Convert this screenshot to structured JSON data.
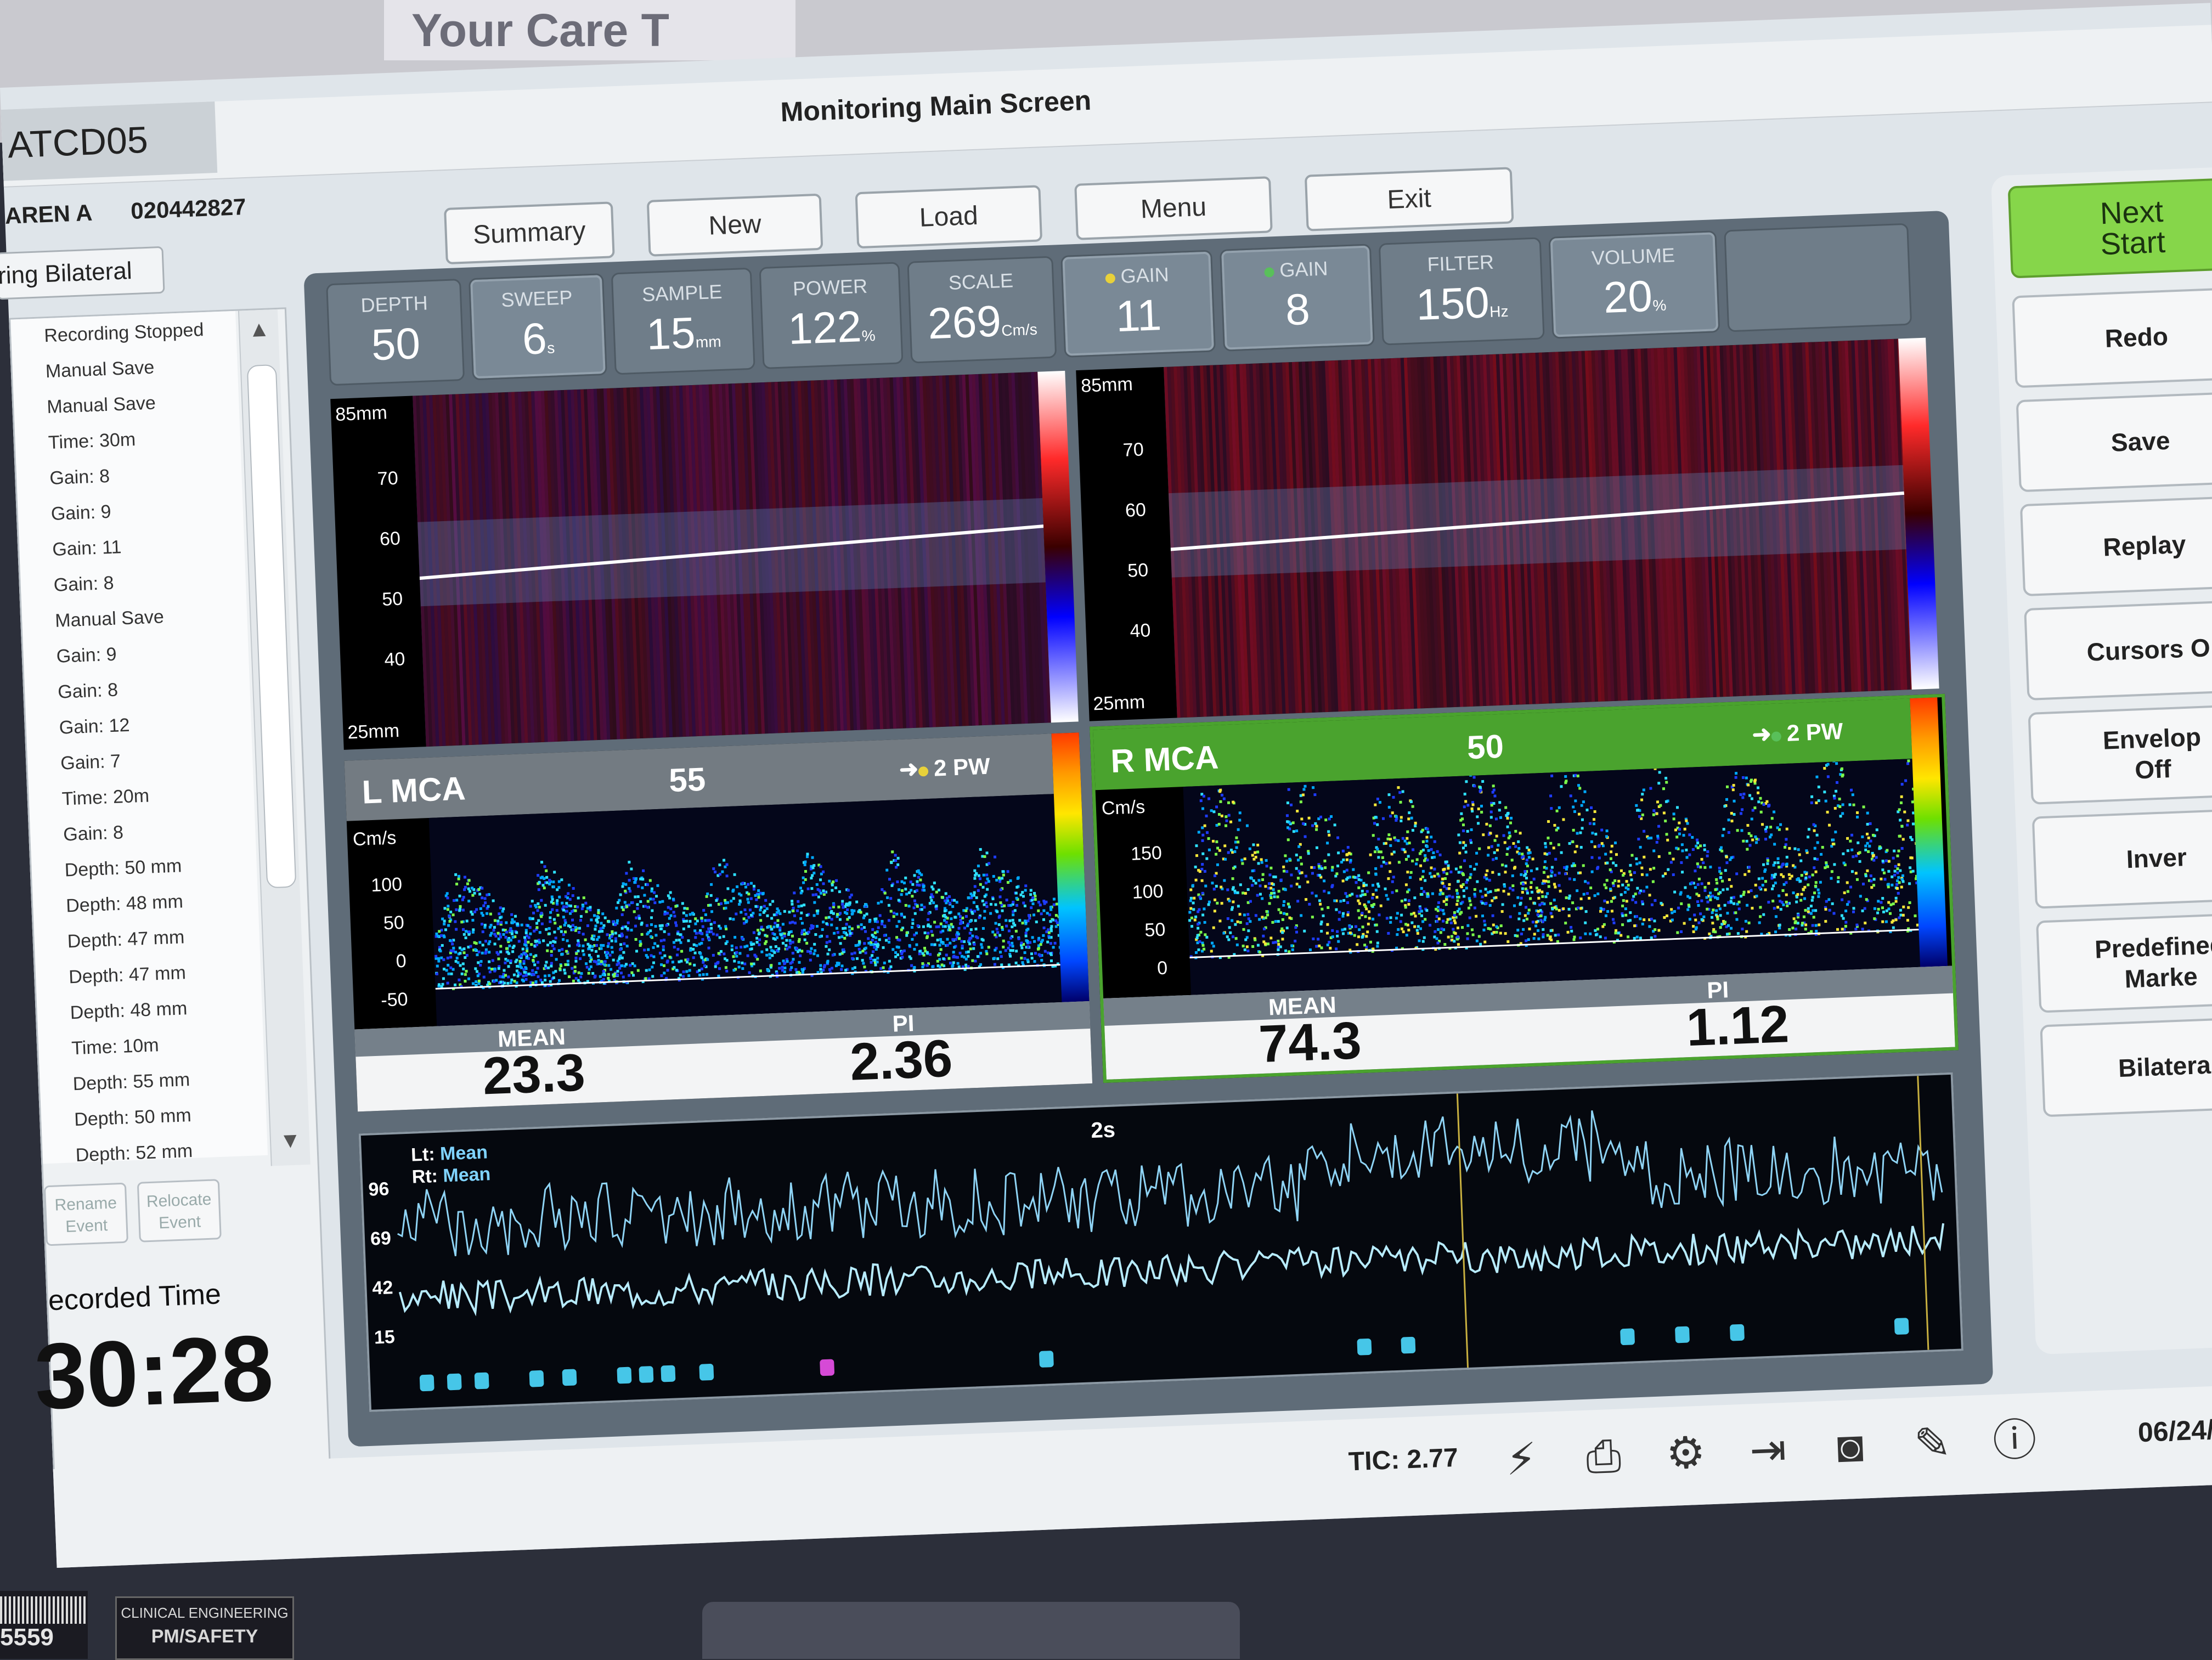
{
  "wall_sign": "Your Care T",
  "header": {
    "device_id": "ATCD05",
    "title": "Monitoring Main Screen",
    "patient_name": "AREN A",
    "patient_id": "020442827",
    "mode": "ring Bilateral"
  },
  "top_buttons": [
    "Summary",
    "New",
    "Load",
    "Menu",
    "Exit"
  ],
  "params": [
    {
      "label": "DEPTH",
      "value": "50",
      "unit": ""
    },
    {
      "label": "SWEEP",
      "value": "6",
      "unit": "s"
    },
    {
      "label": "SAMPLE",
      "value": "15",
      "unit": "mm"
    },
    {
      "label": "POWER",
      "value": "122",
      "unit": "%"
    },
    {
      "label": "SCALE",
      "value": "269",
      "unit": "Cm/s"
    },
    {
      "label": "GAIN",
      "value": "11",
      "unit": ""
    },
    {
      "label": "GAIN",
      "value": "8",
      "unit": ""
    },
    {
      "label": "FILTER",
      "value": "150",
      "unit": "Hz"
    },
    {
      "label": "VOLUME",
      "value": "20",
      "unit": "%"
    }
  ],
  "events": [
    "Recording Stopped",
    "Manual Save",
    "Manual Save",
    "Time: 30m",
    "Gain: 8",
    "Gain: 9",
    "Gain: 11",
    "Gain: 8",
    "Manual Save",
    "Gain: 9",
    "Gain: 8",
    "Gain: 12",
    "Gain: 7",
    "Time: 20m",
    "Gain: 8",
    "Depth: 50 mm",
    "Depth: 48 mm",
    "Depth: 47 mm",
    "Depth: 47 mm",
    "Depth: 48 mm",
    "Time: 10m",
    "Depth: 55 mm",
    "Depth: 50 mm",
    "Depth: 52 mm"
  ],
  "event_buttons": {
    "rename": "Rename Event",
    "relocate": "Relocate Event"
  },
  "recorded": {
    "label": "ecorded Time",
    "time": "30:28"
  },
  "mmode": {
    "left": {
      "top": "85mm",
      "bottom": "25mm",
      "ticks": [
        "70",
        "60",
        "50",
        "40"
      ]
    },
    "right": {
      "top": "85mm",
      "bottom": "25mm",
      "ticks": [
        "70",
        "60",
        "50",
        "40"
      ]
    }
  },
  "left_channel": {
    "name": "L MCA",
    "depth": "55",
    "pw": "2 PW",
    "unit": "Cm/s",
    "ticks": [
      "100",
      "50",
      "0",
      "-50"
    ],
    "mean_label": "MEAN",
    "mean": "23.3",
    "pi_label": "PI",
    "pi": "2.36"
  },
  "right_channel": {
    "name": "R MCA",
    "depth": "50",
    "pw": "2 PW",
    "unit": "Cm/s",
    "ticks": [
      "150",
      "100",
      "50",
      "0"
    ],
    "mean_label": "MEAN",
    "mean": "74.3",
    "pi_label": "PI",
    "pi": "1.12"
  },
  "trend": {
    "lt_label": "Lt:",
    "lt_val": "Mean",
    "rt_label": "Rt:",
    "rt_val": "Mean",
    "window": "2s",
    "ticks": [
      "96",
      "69",
      "42",
      "15"
    ]
  },
  "right_buttons": [
    {
      "label": "Next\nStart"
    },
    {
      "label": "Redo"
    },
    {
      "label": "Save"
    },
    {
      "label": "Replay"
    },
    {
      "label": "Cursors O"
    },
    {
      "label": "Envelop\nOff"
    },
    {
      "label": "Inver"
    },
    {
      "label": "Predefined\nMarke"
    },
    {
      "label": "Bilatera"
    }
  ],
  "status": {
    "tic": "TIC: 2.77",
    "date": "06/24/"
  },
  "bezel": {
    "barcode": "5559",
    "sticker_top": "CLINICAL ENGINEERING",
    "sticker_bottom": "PM/SAFETY"
  },
  "colors": {
    "green_header": "#4aa32e",
    "gray_header": "#737b82",
    "accent_green": "#86d64a"
  }
}
